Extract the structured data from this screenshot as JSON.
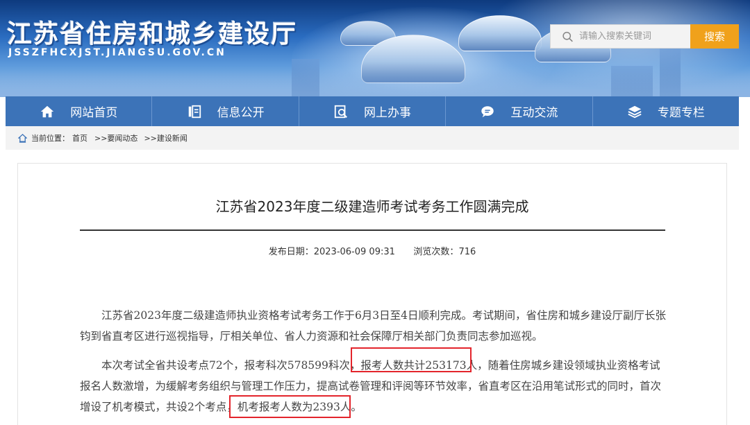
{
  "header": {
    "site_title": "江苏省住房和城乡建设厅",
    "site_url": "JSSZFHCXJST.JIANGSU.GOV.CN",
    "search": {
      "placeholder": "请输入搜索关键词",
      "button_label": "搜索"
    }
  },
  "nav": {
    "items": [
      {
        "label": "网站首页",
        "icon": "home-icon"
      },
      {
        "label": "信息公开",
        "icon": "document-icon"
      },
      {
        "label": "网上办事",
        "icon": "service-search-icon"
      },
      {
        "label": "互动交流",
        "icon": "chat-icon"
      },
      {
        "label": "专题专栏",
        "icon": "layers-icon"
      }
    ]
  },
  "breadcrumb": {
    "prefix": "当前位置：",
    "items": [
      "首页",
      ">>要闻动态",
      ">>建设新闻"
    ]
  },
  "article": {
    "title": "江苏省2023年度二级建造师考试考务工作圆满完成",
    "publish_label": "发布日期：",
    "publish_date": "2023-06-09 09:31",
    "views_label": "浏览次数：",
    "views": "716",
    "paragraph1": "江苏省2023年度二级建造师执业资格考试考务工作于6月3日至4日顺利完成。考试期间，省住房和城乡建设厅副厅长张钧到省直考区进行巡视指导，厅相关单位、省人力资源和社会保障厅相关部门负责同志参加巡视。",
    "paragraph2_a": "本次考试全省共设考点72个，报考科次578599科次，",
    "paragraph2_hl1": "报考人数共计253173人",
    "paragraph2_b": "，随着住房城乡建设领域执业资格考试报名人数激增，为缓解考务组织与管理工作压力，提高试卷管理和评阅等环节效率，省直考区在沿用笔试形式的同时，首次增设了机考模式，共设2个考点，",
    "paragraph2_hl2": "机考报考人数为2393人",
    "paragraph2_c": "。"
  },
  "colors": {
    "nav_bg": "#3c73b8",
    "search_button": "#f0a11b",
    "highlight_box": "#e3242b"
  }
}
